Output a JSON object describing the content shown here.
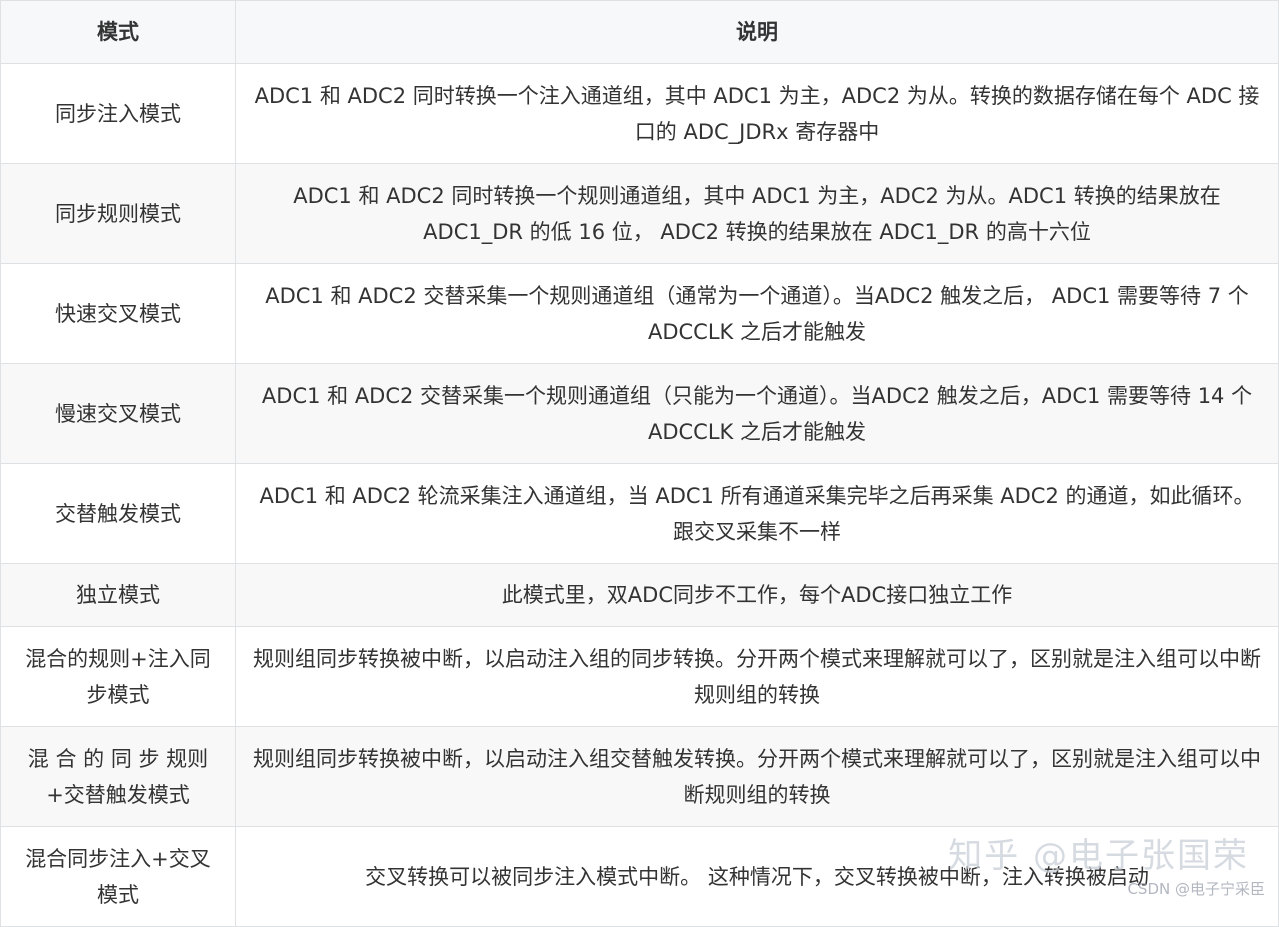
{
  "table": {
    "headers": [
      "模式",
      "说明"
    ],
    "rows": [
      {
        "mode": "同步注入模式",
        "desc": "ADC1 和 ADC2 同时转换一个注入通道组，其中 ADC1 为主，ADC2 为从。转换的数据存储在每个 ADC 接口的 ADC_JDRx 寄存器中"
      },
      {
        "mode": "同步规则模式",
        "desc": "ADC1 和 ADC2 同时转换一个规则通道组，其中 ADC1 为主，ADC2 为从。ADC1 转换的结果放在 ADC1_DR 的低 16 位， ADC2 转换的结果放在 ADC1_DR 的高十六位"
      },
      {
        "mode": "快速交叉模式",
        "desc": "ADC1 和 ADC2 交替采集一个规则通道组（通常为一个通道）。当ADC2 触发之后， ADC1 需要等待 7 个 ADCCLK 之后才能触发"
      },
      {
        "mode": "慢速交叉模式",
        "desc": "ADC1 和 ADC2 交替采集一个规则通道组（只能为一个通道）。当ADC2 触发之后，ADC1 需要等待 14 个 ADCCLK 之后才能触发"
      },
      {
        "mode": "交替触发模式",
        "desc": "ADC1 和 ADC2 轮流采集注入通道组，当 ADC1 所有通道采集完毕之后再采集 ADC2 的通道，如此循环。跟交叉采集不一样"
      },
      {
        "mode": "独立模式",
        "desc": "此模式里，双ADC同步不工作，每个ADC接口独立工作"
      },
      {
        "mode": "混合的规则+注入同步模式",
        "desc": "规则组同步转换被中断，以启动注入组的同步转换。分开两个模式来理解就可以了，区别就是注入组可以中断规则组的转换"
      },
      {
        "mode": "混 合 的 同 步 规则 +交替触发模式",
        "desc": "规则组同步转换被中断，以启动注入组交替触发转换。分开两个模式来理解就可以了，区别就是注入组可以中断规则组的转换"
      },
      {
        "mode": "混合同步注入+交叉模式",
        "desc": "交叉转换可以被同步注入模式中断。 这种情况下，交叉转换被中断，注入转换被启动"
      }
    ]
  },
  "watermarks": {
    "zhihu": "知乎 @电子张国荣",
    "csdn": "CSDN @电子宁采臣"
  }
}
